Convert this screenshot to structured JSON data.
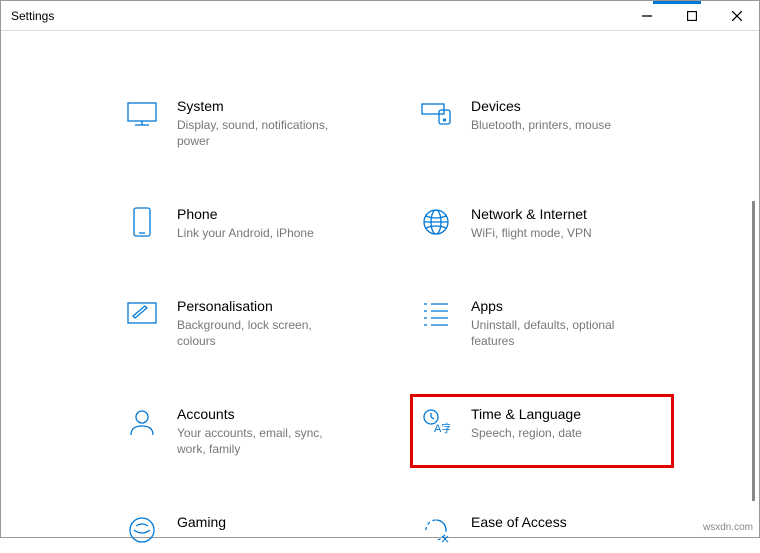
{
  "window": {
    "title": "Settings"
  },
  "watermark": "wsxdn.com",
  "categories": [
    {
      "label": "System",
      "sub": "Display, sound, notifications, power"
    },
    {
      "label": "Devices",
      "sub": "Bluetooth, printers, mouse"
    },
    {
      "label": "Phone",
      "sub": "Link your Android, iPhone"
    },
    {
      "label": "Network & Internet",
      "sub": "WiFi, flight mode, VPN"
    },
    {
      "label": "Personalisation",
      "sub": "Background, lock screen, colours"
    },
    {
      "label": "Apps",
      "sub": "Uninstall, defaults, optional features"
    },
    {
      "label": "Accounts",
      "sub": "Your accounts, email, sync, work, family"
    },
    {
      "label": "Time & Language",
      "sub": "Speech, region, date"
    },
    {
      "label": "Gaming",
      "sub": ""
    },
    {
      "label": "Ease of Access",
      "sub": ""
    }
  ]
}
